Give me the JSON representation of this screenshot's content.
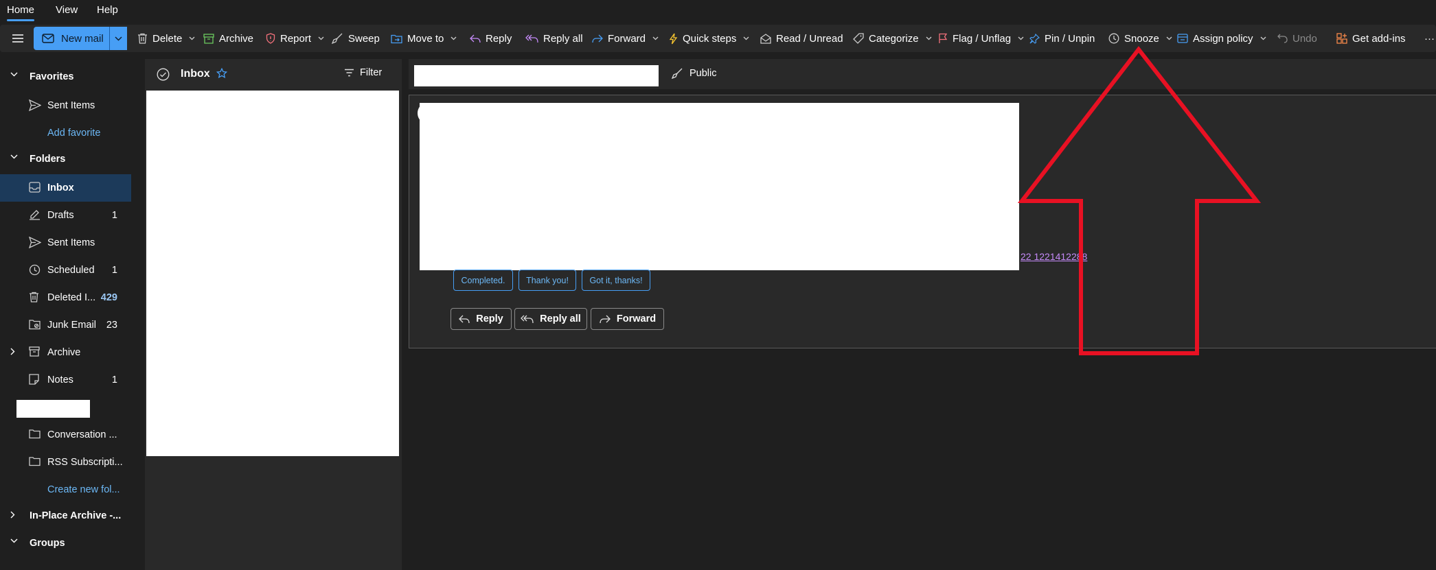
{
  "menu": {
    "tabs": [
      "Home",
      "View",
      "Help"
    ]
  },
  "ribbon": {
    "new_mail": "New mail",
    "delete": "Delete",
    "archive": "Archive",
    "report": "Report",
    "sweep": "Sweep",
    "move_to": "Move to",
    "reply": "Reply",
    "reply_all": "Reply all",
    "forward": "Forward",
    "quick_steps": "Quick steps",
    "read_unread": "Read / Unread",
    "categorize": "Categorize",
    "flag_unflag": "Flag / Unflag",
    "pin_unpin": "Pin / Unpin",
    "snooze": "Snooze",
    "assign_policy": "Assign policy",
    "undo": "Undo",
    "get_addins": "Get add-ins",
    "more": "···"
  },
  "sidebar": {
    "favorites": {
      "title": "Favorites",
      "items": [
        {
          "label": "Sent Items"
        }
      ],
      "add_favorite": "Add favorite"
    },
    "folders": {
      "title": "Folders",
      "items": [
        {
          "label": "Inbox",
          "count": ""
        },
        {
          "label": "Drafts",
          "count": "1"
        },
        {
          "label": "Sent Items",
          "count": ""
        },
        {
          "label": "Scheduled",
          "count": "1"
        },
        {
          "label": "Deleted I...",
          "count": "429"
        },
        {
          "label": "Junk Email",
          "count": "23"
        },
        {
          "label": "Archive",
          "count": ""
        },
        {
          "label": "Notes",
          "count": "1"
        },
        {
          "label": "Conversation ...",
          "count": ""
        },
        {
          "label": "RSS Subscripti...",
          "count": ""
        }
      ],
      "create_new": "Create new fol..."
    },
    "in_place_archive": "In-Place Archive -...",
    "groups": "Groups"
  },
  "list": {
    "title": "Inbox",
    "filter": "Filter"
  },
  "reading": {
    "visibility": "Public",
    "partial_id": "22 1221412288",
    "quick_replies": [
      "Completed.",
      "Thank you!",
      "Got it, thanks!"
    ],
    "actions": {
      "reply": "Reply",
      "reply_all": "Reply all",
      "forward": "Forward"
    }
  },
  "colors": {
    "accent": "#479ef5",
    "annotation": "#e81123",
    "selected": "#1c3a5a"
  }
}
